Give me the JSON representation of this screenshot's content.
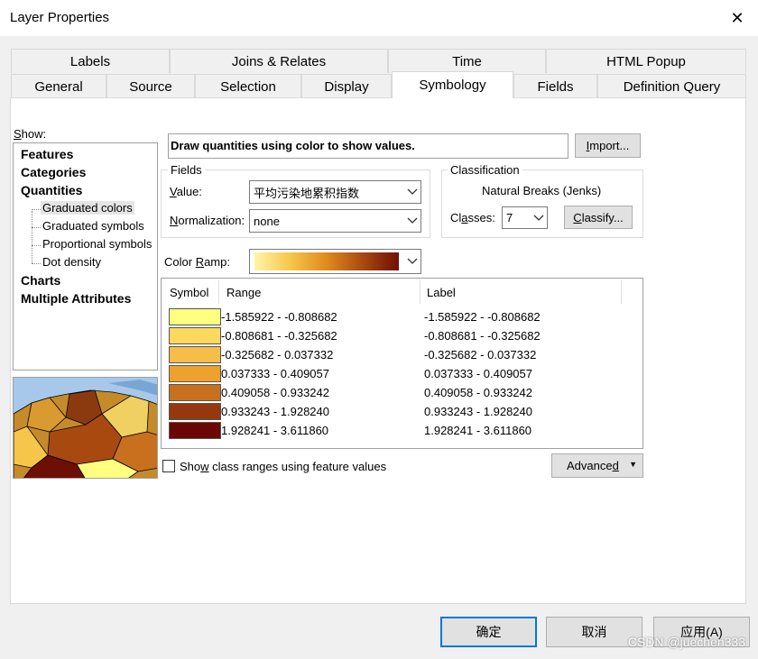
{
  "window": {
    "title": "Layer Properties",
    "close_glyph": "✕"
  },
  "tabs_row1": [
    "Labels",
    "Joins & Relates",
    "Time",
    "HTML Popup"
  ],
  "tabs_row2": [
    "General",
    "Source",
    "Selection",
    "Display",
    "Symbology",
    "Fields",
    "Definition Query"
  ],
  "active_tab": "Symbology",
  "show": {
    "label": "Show:",
    "items": [
      "Features",
      "Categories",
      "Quantities"
    ],
    "quantities_subitems": [
      "Graduated colors",
      "Graduated symbols",
      "Proportional symbols",
      "Dot density"
    ],
    "items_after": [
      "Charts",
      "Multiple Attributes"
    ],
    "selected": "Graduated colors"
  },
  "description": "Draw quantities using color to show values.",
  "import_button": "Import...",
  "fields": {
    "group_title": "Fields",
    "value_label": "Value:",
    "value": "平均污染地累积指数",
    "normalization_label": "Normalization:",
    "normalization": "none"
  },
  "classification": {
    "group_title": "Classification",
    "method": "Natural Breaks (Jenks)",
    "classes_label": "Classes:",
    "classes": "7",
    "classify_button": "Classify..."
  },
  "color_ramp": {
    "label": "Color Ramp:",
    "colors": [
      "#fff5a8",
      "#f6c64a",
      "#e08a1e",
      "#a84a10",
      "#6e0f05"
    ]
  },
  "table": {
    "headers": {
      "symbol": "Symbol",
      "range": "Range",
      "label": "Label"
    },
    "rows": [
      {
        "color": "#ffff80",
        "range": "-1.585922 - -0.808682",
        "label": "-1.585922 - -0.808682"
      },
      {
        "color": "#fbd95c",
        "range": "-0.808681 - -0.325682",
        "label": "-0.808681 - -0.325682"
      },
      {
        "color": "#f6bd48",
        "range": "-0.325682 - 0.037332",
        "label": "-0.325682 - 0.037332"
      },
      {
        "color": "#eea12c",
        "range": "0.037333 - 0.409057",
        "label": "0.037333 - 0.409057"
      },
      {
        "color": "#c8701e",
        "range": "0.409058 - 0.933242",
        "label": "0.409058 - 0.933242"
      },
      {
        "color": "#96380f",
        "range": "0.933243 - 1.928240",
        "label": "0.933243 - 1.928240"
      },
      {
        "color": "#6a0704",
        "range": "1.928241 - 3.611860",
        "label": "1.928241 - 3.611860"
      }
    ]
  },
  "show_class_ranges": "Show class ranges using feature values",
  "advanced_button": "Advanced",
  "footer": {
    "ok": "确定",
    "cancel": "取消",
    "apply": "应用(A)"
  },
  "watermark": "CSDN @juechen333"
}
